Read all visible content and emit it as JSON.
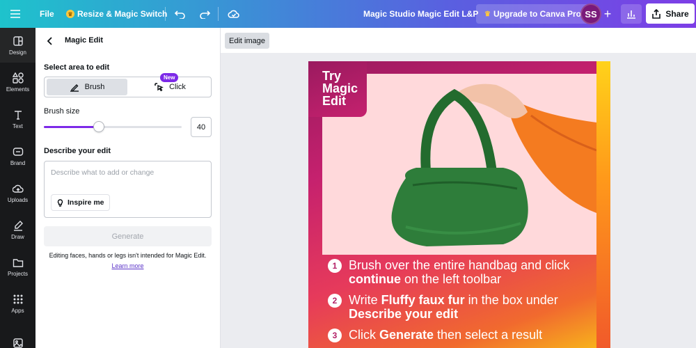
{
  "topbar": {
    "file": "File",
    "resize": "Resize & Magic Switch",
    "doc_title": "Magic Studio Magic Edit L&P",
    "upgrade": "Upgrade to Canva Pro",
    "avatar": "SS",
    "share": "Share"
  },
  "rail": {
    "items": [
      {
        "label": "Design",
        "icon": "layout-icon"
      },
      {
        "label": "Elements",
        "icon": "shapes-icon"
      },
      {
        "label": "Text",
        "icon": "text-icon"
      },
      {
        "label": "Brand",
        "icon": "brand-icon"
      },
      {
        "label": "Uploads",
        "icon": "cloud-upload-icon"
      },
      {
        "label": "Draw",
        "icon": "pen-icon"
      },
      {
        "label": "Projects",
        "icon": "folder-icon"
      },
      {
        "label": "Apps",
        "icon": "apps-grid-icon"
      }
    ]
  },
  "panel": {
    "title": "Magic Edit",
    "select_area_label": "Select area to edit",
    "new_badge": "New",
    "brush_label": "Brush",
    "click_label": "Click",
    "brush_size_label": "Brush size",
    "brush_size_value": "40",
    "brush_size_fraction": 0.4,
    "describe_label": "Describe your edit",
    "describe_placeholder": "Describe what to add or change",
    "inspire_label": "Inspire me",
    "generate_label": "Generate",
    "disclaimer": "Editing faces, hands or legs isn't intended for Magic Edit.",
    "learn_more": "Learn more"
  },
  "canvas": {
    "edit_image_label": "Edit image",
    "design_title": "Try\nMagic\nEdit",
    "steps": [
      {
        "num": "1",
        "parts": [
          {
            "t": "Brush over the entire handbag and click ",
            "b": false
          },
          {
            "t": "continue",
            "b": true
          },
          {
            "t": " on the left toolbar",
            "b": false
          }
        ]
      },
      {
        "num": "2",
        "parts": [
          {
            "t": "Write ",
            "b": false
          },
          {
            "t": "Fluffy faux fur",
            "b": true
          },
          {
            "t": " in the box under ",
            "b": false
          },
          {
            "t": "Describe your edit",
            "b": true
          }
        ]
      },
      {
        "num": "3",
        "parts": [
          {
            "t": "Click ",
            "b": false
          },
          {
            "t": "Generate",
            "b": true
          },
          {
            "t": " then select a result",
            "b": false
          }
        ]
      }
    ]
  },
  "colors": {
    "accent": "#7d2ae8",
    "bag_green": "#2e7d3a",
    "sleeve_orange": "#f47b20"
  }
}
